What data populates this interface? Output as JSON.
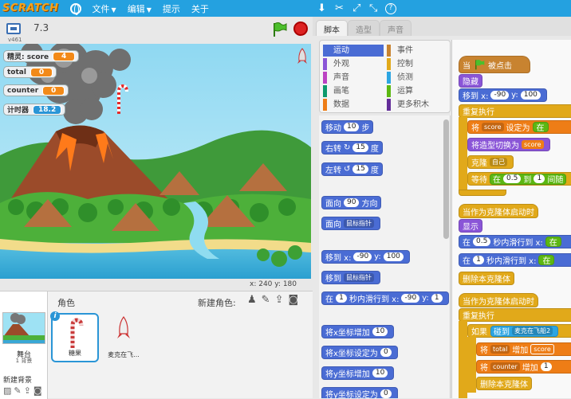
{
  "menubar": {
    "logo": "SCRATCH",
    "file": "文件",
    "edit": "编辑",
    "tips": "提示",
    "about": "关于"
  },
  "stage_header": {
    "version": "v461",
    "title": "7.3"
  },
  "monitors": [
    {
      "label": "精灵: score",
      "value": "4",
      "color": "orange"
    },
    {
      "label": "total",
      "value": "0",
      "color": "orange"
    },
    {
      "label": "counter",
      "value": "0",
      "color": "orange"
    },
    {
      "label": "计时器",
      "value": "18.2",
      "color": "blue"
    }
  ],
  "coords": "x: 240  y: 180",
  "sprites_pane": {
    "heading": "角色",
    "new_sprite": "新建角色:",
    "stage_name": "舞台",
    "stage_bg_count": "1 背景",
    "new_backdrop": "新建背景",
    "sprites": [
      {
        "name": "糖果",
        "selected": true
      },
      {
        "name": "麦克在飞..."
      }
    ]
  },
  "tabs": {
    "scripts": "脚本",
    "costumes": "造型",
    "sounds": "声音"
  },
  "categories": {
    "left": [
      {
        "label": "运动",
        "color": "#4a6cd4",
        "selected": true
      },
      {
        "label": "外观",
        "color": "#8a55d7"
      },
      {
        "label": "声音",
        "color": "#bb42c3"
      },
      {
        "label": "画笔",
        "color": "#0e9a6c"
      },
      {
        "label": "数据",
        "color": "#ee7d16"
      }
    ],
    "right": [
      {
        "label": "事件",
        "color": "#c88330"
      },
      {
        "label": "控制",
        "color": "#e1a91a"
      },
      {
        "label": "侦测",
        "color": "#2ca5e2"
      },
      {
        "label": "运算",
        "color": "#5cb712"
      },
      {
        "label": "更多积木",
        "color": "#632d99"
      }
    ]
  },
  "palette": {
    "move": "移动",
    "move_n": "10",
    "steps": "步",
    "turn_right": "右转",
    "turn_r_n": "15",
    "deg": "度",
    "turn_left": "左转",
    "turn_l_n": "15",
    "point_dir": "面向",
    "point_dir_n": "90",
    "direction": "方向",
    "point_towards": "面向",
    "mouse_pointer": "鼠标指针",
    "goto_xy": "移到 x:",
    "goto_x": "-90",
    "goto_y_label": "y:",
    "goto_y": "100",
    "goto": "移到",
    "goto_target": "鼠标指针",
    "glide_in": "在",
    "glide_secs": "1",
    "glide_text": "秒内滑行到 x:",
    "glide_x": "-90",
    "glide_y_label": "y:",
    "glide_y": "1",
    "change_x": "将x坐标增加",
    "change_x_n": "10",
    "set_x": "将x坐标设定为",
    "set_x_n": "0",
    "change_y": "将y坐标增加",
    "change_y_n": "10",
    "set_y": "将y坐标设定为",
    "set_y_n": "0"
  },
  "script": {
    "when_flag": "当",
    "when_flag2": "被点击",
    "hide": "隐藏",
    "goto": "移到 x:",
    "goto_x": "-90",
    "goto_y_label": "y:",
    "goto_y": "100",
    "forever": "重复执行",
    "set": "将",
    "set_var": "score",
    "set_to": "设定为",
    "set_in": "在",
    "switch_costume": "将造型切换为",
    "costume_var": "score",
    "clone": "克隆",
    "clone_target": "自己",
    "wait": "等待",
    "wait_in": "在",
    "wait_a": "0.5",
    "wait_to": "到",
    "wait_b": "1",
    "wait_rand": "间随",
    "when_clone": "当作为克隆体启动时",
    "show": "显示",
    "glide1_in": "在",
    "glide1_secs": "0.5",
    "glide1_text": "秒内滑行到 x:",
    "glide1_in2": "在",
    "glide2_in": "在",
    "glide2_secs": "1",
    "glide2_text": "秒内滑行到 x:",
    "glide2_in2": "在",
    "delete_clone": "删除本克隆体",
    "when_clone2": "当作为克隆体启动时",
    "forever2": "重复执行",
    "if": "如果",
    "touching": "碰到",
    "touch_target": "麦克在飞船2",
    "set_total": "将",
    "total_var": "total",
    "total_change": "增加",
    "total_score": "score",
    "set_counter": "将",
    "counter_var": "counter",
    "counter_change": "增加",
    "counter_n": "1",
    "delete_clone2": "删除本克隆体"
  }
}
